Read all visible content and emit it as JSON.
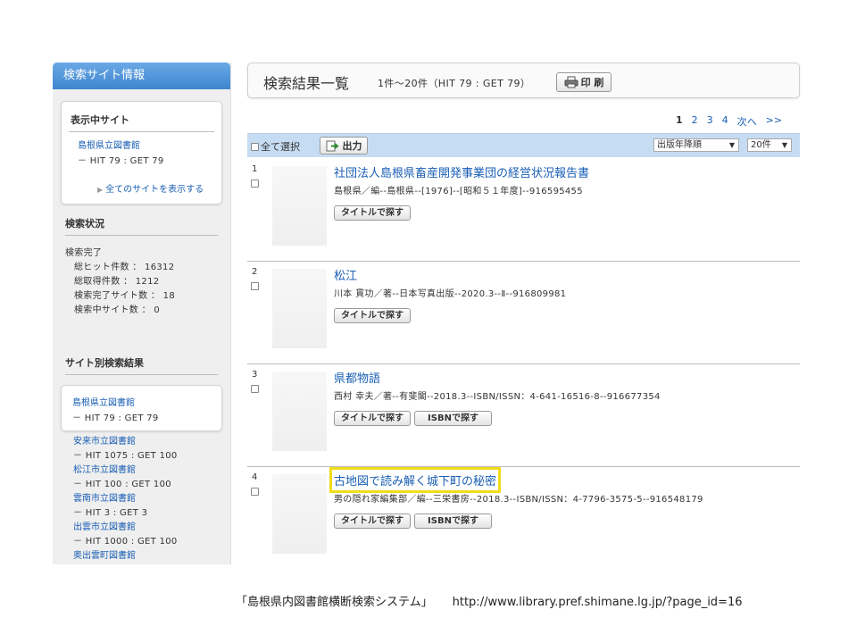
{
  "sidebar": {
    "header": "検索サイト情報",
    "current": {
      "title": "表示中サイト",
      "library": "島根県立図書館",
      "hit": "－ HIT 79 : GET 79",
      "show_all": "全てのサイトを表示する"
    },
    "status": {
      "title": "検索状況",
      "done": "検索完了",
      "total_hits": "総ヒット件数 ： 16312",
      "total_gets": "総取得件数 ： 1212",
      "completed_sites": "検索完了サイト数 ： 18",
      "searching_sites": "検索中サイト数 ： 0"
    },
    "by_site": {
      "title": "サイト別検索結果",
      "selected": {
        "library": "島根県立図書館",
        "hit": "－ HIT 79 : GET 79"
      },
      "sites": [
        {
          "library": "安来市立図書館",
          "hit": "－ HIT 1075 : GET 100"
        },
        {
          "library": "松江市立図書館",
          "hit": "－ HIT 100 : GET 100"
        },
        {
          "library": "雲南市立図書館",
          "hit": "－ HIT 3 : GET 3"
        },
        {
          "library": "出雲市立図書館",
          "hit": "－ HIT 1000 : GET 100"
        },
        {
          "library": "奥出雲町図書館",
          "hit": ""
        }
      ]
    }
  },
  "results": {
    "title": "検索結果一覧",
    "range": "1件～20件（HIT 79 : GET 79）",
    "print_label": "印 刷",
    "pager": {
      "current": "1",
      "pages": [
        "2",
        "3",
        "4"
      ],
      "next": "次へ",
      "last": ">>"
    },
    "select_all": "全て選択",
    "export_label": "出力",
    "sort_value": "出版年降順",
    "count_value": "20件",
    "items": [
      {
        "num": "1",
        "title": "社団法人島根県畜産開発事業団の経営状況報告書",
        "meta": "島根県／編--島根県--[1976]--[昭和５１年度]--916595455",
        "buttons": [
          "タイトルで探す"
        ]
      },
      {
        "num": "2",
        "title": "松江",
        "meta": "川本 貫功／著--日本写真出版--2020.3--Ⅱ--916809981",
        "buttons": [
          "タイトルで探す"
        ]
      },
      {
        "num": "3",
        "title": "県都物語",
        "meta": "西村 幸夫／著--有斐閣--2018.3--ISBN/ISSN：4-641-16516-8--916677354",
        "buttons": [
          "タイトルで探す",
          "ISBNで探す"
        ]
      },
      {
        "num": "4",
        "title": "古地図で読み解く城下町の秘密",
        "meta": "男の隠れ家編集部／編--三栄書房--2018.3--ISBN/ISSN：4-7796-3575-5--916548179",
        "buttons": [
          "タイトルで探す",
          "ISBNで探す"
        ]
      }
    ]
  },
  "footer": {
    "system_name": "「島根県内図書館横断検索システム」",
    "url": "http://www.library.pref.shimane.lg.jp/?page_id=16"
  },
  "colors": {
    "link": "#1a5fb4",
    "header_blue": "#3f86cf",
    "toolbar": "#c6dcf3",
    "highlight": "#f0dc19"
  }
}
